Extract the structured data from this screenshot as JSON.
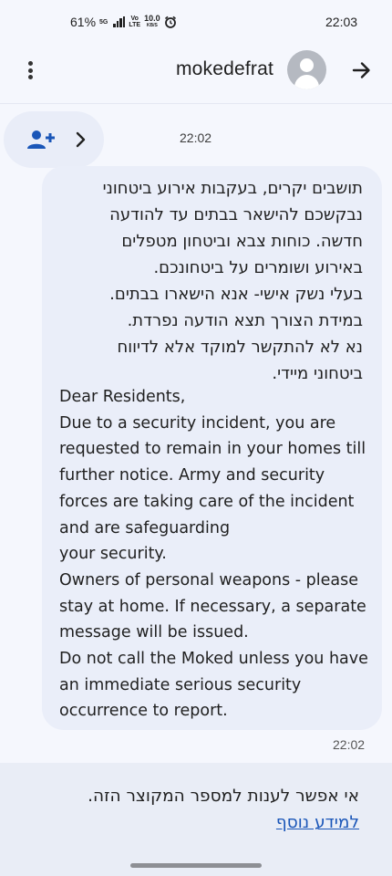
{
  "status_bar": {
    "battery": "61%",
    "network_label_top": "5G",
    "volte_top": "Vo",
    "volte_bottom": "LTE",
    "speed_value": "10.0",
    "speed_unit": "KB/S",
    "time": "22:03"
  },
  "header": {
    "title": "mokedefrat",
    "menu_icon": "more-vert-icon",
    "avatar_icon": "person-icon",
    "back_icon": "arrow-forward-icon"
  },
  "contact_chip": {
    "add_icon": "person-add-icon",
    "chevron_icon": "chevron-right-icon"
  },
  "conversation": {
    "timestamp_top": "22:02",
    "message": {
      "hebrew_lines": [
        "תושבים יקרים, בעקבות אירוע ביטחוני",
        "נבקשכם להישאר בבתים עד להודעה",
        "חדשה. כוחות צבא וביטחון מטפלים",
        "באירוע ושומרים על ביטחונכם.",
        "בעלי נשק אישי- אנא הישארו בבתים.",
        "במידת הצורך תצא הודעה נפרדת.",
        "נא לא להתקשר למוקד אלא לדיווח",
        "ביטחוני מיידי."
      ],
      "english_lines": [
        "Dear Residents,",
        "Due to a security incident, you are",
        "requested to remain in your homes till",
        "further notice. Army and security",
        "forces are taking care of the incident",
        "and are safeguarding",
        "your security.",
        "Owners of personal weapons - please",
        "stay at home. If necessary, a separate",
        "message will be issued.",
        "Do not call the Moked unless you have",
        "an immediate serious security",
        "occurrence to report."
      ]
    },
    "timestamp_bottom": "22:02"
  },
  "footer": {
    "notice": "אי אפשר לענות למספר המקוצר הזה.",
    "learn_more": "למידע נוסף"
  },
  "colors": {
    "background": "#f5f7fd",
    "bubble": "#eaeef9",
    "link": "#1a56b8",
    "accent_icon": "#1a56b8"
  }
}
